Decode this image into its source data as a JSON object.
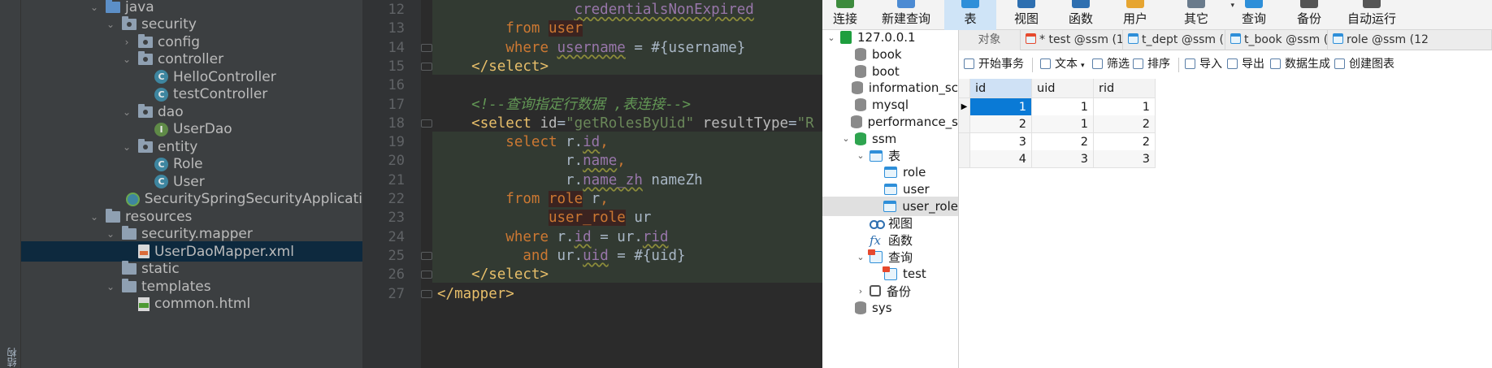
{
  "project_tree": {
    "side_label": "结构",
    "items": [
      {
        "label": "java",
        "indent": 2,
        "chev": "down",
        "icon": "java-folder"
      },
      {
        "label": "security",
        "indent": 3,
        "chev": "down",
        "icon": "package"
      },
      {
        "label": "config",
        "indent": 4,
        "chev": "right",
        "icon": "package"
      },
      {
        "label": "controller",
        "indent": 4,
        "chev": "down",
        "icon": "package"
      },
      {
        "label": "HelloController",
        "indent": 5,
        "chev": "",
        "icon": "class"
      },
      {
        "label": "testController",
        "indent": 5,
        "chev": "",
        "icon": "class"
      },
      {
        "label": "dao",
        "indent": 4,
        "chev": "down",
        "icon": "package"
      },
      {
        "label": "UserDao",
        "indent": 5,
        "chev": "",
        "icon": "interface"
      },
      {
        "label": "entity",
        "indent": 4,
        "chev": "down",
        "icon": "package"
      },
      {
        "label": "Role",
        "indent": 5,
        "chev": "",
        "icon": "class"
      },
      {
        "label": "User",
        "indent": 5,
        "chev": "",
        "icon": "class"
      },
      {
        "label": "SecuritySpringSecurityApplicati",
        "indent": 4,
        "chev": "",
        "icon": "spring-class"
      },
      {
        "label": "resources",
        "indent": 2,
        "chev": "down",
        "icon": "resources-folder"
      },
      {
        "label": "security.mapper",
        "indent": 3,
        "chev": "down",
        "icon": "folder"
      },
      {
        "label": "UserDaoMapper.xml",
        "indent": 4,
        "chev": "",
        "icon": "xml-file",
        "selected": true
      },
      {
        "label": "static",
        "indent": 3,
        "chev": "",
        "icon": "folder"
      },
      {
        "label": "templates",
        "indent": 3,
        "chev": "down",
        "icon": "folder"
      },
      {
        "label": "common.html",
        "indent": 4,
        "chev": "",
        "icon": "html-file"
      }
    ]
  },
  "editor": {
    "line_numbers": [
      "12",
      "13",
      "14",
      "15",
      "16",
      "17",
      "18",
      "19",
      "20",
      "21",
      "22",
      "23",
      "24",
      "25",
      "26",
      "27"
    ],
    "lines": [
      [
        {
          "t": "                ",
          "c": ""
        },
        {
          "t": "credentialsNonExpired",
          "c": "col"
        }
      ],
      [
        {
          "t": "        ",
          "c": ""
        },
        {
          "t": "from ",
          "c": "kw"
        },
        {
          "t": "user",
          "c": "tref"
        }
      ],
      [
        {
          "t": "        ",
          "c": ""
        },
        {
          "t": "where ",
          "c": "kw"
        },
        {
          "t": "username",
          "c": "col"
        },
        {
          "t": " = #{username}",
          "c": ""
        }
      ],
      [
        {
          "t": "    ",
          "c": ""
        },
        {
          "t": "</select>",
          "c": "tag"
        }
      ],
      [
        {
          "t": "",
          "c": ""
        }
      ],
      [
        {
          "t": "    ",
          "c": ""
        },
        {
          "t": "<!--查询指定行数据 ,表连接-->",
          "c": "cmt"
        }
      ],
      [
        {
          "t": "    ",
          "c": ""
        },
        {
          "t": "<select ",
          "c": "tag"
        },
        {
          "t": "id",
          "c": "attr"
        },
        {
          "t": "=",
          "c": ""
        },
        {
          "t": "\"getRolesByUid\"",
          "c": "str"
        },
        {
          "t": " resultType",
          "c": "attr"
        },
        {
          "t": "=",
          "c": ""
        },
        {
          "t": "\"R",
          "c": "str"
        }
      ],
      [
        {
          "t": "        ",
          "c": ""
        },
        {
          "t": "select ",
          "c": "kw"
        },
        {
          "t": "r.",
          "c": ""
        },
        {
          "t": "id",
          "c": "col"
        },
        {
          "t": ",",
          "c": "kw"
        }
      ],
      [
        {
          "t": "               ",
          "c": ""
        },
        {
          "t": "r.",
          "c": ""
        },
        {
          "t": "name",
          "c": "col"
        },
        {
          "t": ",",
          "c": "kw"
        }
      ],
      [
        {
          "t": "               ",
          "c": ""
        },
        {
          "t": "r.",
          "c": ""
        },
        {
          "t": "name_zh",
          "c": "col"
        },
        {
          "t": " nameZh",
          "c": ""
        }
      ],
      [
        {
          "t": "        ",
          "c": ""
        },
        {
          "t": "from ",
          "c": "kw"
        },
        {
          "t": "role",
          "c": "tref"
        },
        {
          "t": " r",
          "c": ""
        },
        {
          "t": ",",
          "c": "kw"
        }
      ],
      [
        {
          "t": "             ",
          "c": ""
        },
        {
          "t": "user_role",
          "c": "tref"
        },
        {
          "t": " ur",
          "c": ""
        }
      ],
      [
        {
          "t": "        ",
          "c": ""
        },
        {
          "t": "where ",
          "c": "kw"
        },
        {
          "t": "r.",
          "c": ""
        },
        {
          "t": "id",
          "c": "col"
        },
        {
          "t": " = ur.",
          "c": ""
        },
        {
          "t": "rid",
          "c": "col"
        }
      ],
      [
        {
          "t": "          ",
          "c": ""
        },
        {
          "t": "and ",
          "c": "kw"
        },
        {
          "t": "ur.",
          "c": ""
        },
        {
          "t": "uid",
          "c": "col"
        },
        {
          "t": " = #{uid}",
          "c": ""
        }
      ],
      [
        {
          "t": "    ",
          "c": ""
        },
        {
          "t": "</select>",
          "c": "tag"
        }
      ],
      [
        {
          "t": "</mapper>",
          "c": "tag"
        }
      ]
    ]
  },
  "navicat": {
    "toolbar": [
      {
        "label": "连接",
        "color": "#3d8b3d"
      },
      {
        "label": "新建查询",
        "color": "#4c8bd3"
      },
      {
        "label": "表",
        "color": "#2e8fd9",
        "active": true
      },
      {
        "label": "视图",
        "color": "#2e6fb0"
      },
      {
        "label": "函数",
        "color": "#2e6fb0"
      },
      {
        "label": "用户",
        "color": "#e6a531"
      },
      {
        "label": "其它",
        "color": "#6a7b8c",
        "dropdown": "▾"
      },
      {
        "label": "查询",
        "color": "#2e8fd9"
      },
      {
        "label": "备份",
        "color": "#555555"
      },
      {
        "label": "自动运行",
        "color": "#555555"
      }
    ],
    "tree": [
      {
        "label": "127.0.0.1",
        "indent": 0,
        "chev": "down",
        "icon": "connection"
      },
      {
        "label": "book",
        "indent": 1,
        "chev": "",
        "icon": "db"
      },
      {
        "label": "boot",
        "indent": 1,
        "chev": "",
        "icon": "db"
      },
      {
        "label": "information_sc",
        "indent": 1,
        "chev": "",
        "icon": "db"
      },
      {
        "label": "mysql",
        "indent": 1,
        "chev": "",
        "icon": "db"
      },
      {
        "label": "performance_s",
        "indent": 1,
        "chev": "",
        "icon": "db"
      },
      {
        "label": "ssm",
        "indent": 1,
        "chev": "down",
        "icon": "db-open"
      },
      {
        "label": "表",
        "indent": 2,
        "chev": "down",
        "icon": "table"
      },
      {
        "label": "role",
        "indent": 3,
        "chev": "",
        "icon": "table"
      },
      {
        "label": "user",
        "indent": 3,
        "chev": "",
        "icon": "table"
      },
      {
        "label": "user_role",
        "indent": 3,
        "chev": "",
        "icon": "table",
        "selected": true
      },
      {
        "label": "视图",
        "indent": 2,
        "chev": "",
        "icon": "view"
      },
      {
        "label": "函数",
        "indent": 2,
        "chev": "",
        "icon": "function"
      },
      {
        "label": "查询",
        "indent": 2,
        "chev": "down",
        "icon": "query"
      },
      {
        "label": "test",
        "indent": 3,
        "chev": "",
        "icon": "query"
      },
      {
        "label": "备份",
        "indent": 2,
        "chev": "right",
        "icon": "backup"
      },
      {
        "label": "sys",
        "indent": 1,
        "chev": "",
        "icon": "db"
      }
    ],
    "tabs": [
      {
        "label": "对象",
        "kind": "obj"
      },
      {
        "label": "* test @ssm (1...",
        "kind": "query"
      },
      {
        "label": "t_dept @ssm (...",
        "kind": "table"
      },
      {
        "label": "t_book @ssm (...",
        "kind": "table"
      },
      {
        "label": "role @ssm (12",
        "kind": "table"
      }
    ],
    "tools": [
      {
        "label": "开始事务"
      },
      {
        "label": "文本",
        "dropdown": "▾"
      },
      {
        "label": "筛选"
      },
      {
        "label": "排序"
      },
      {
        "label": "导入"
      },
      {
        "label": "导出"
      },
      {
        "label": "数据生成"
      },
      {
        "label": "创建图表"
      }
    ],
    "grid": {
      "columns": [
        "id",
        "uid",
        "rid"
      ],
      "rows": [
        [
          "1",
          "1",
          "1"
        ],
        [
          "2",
          "1",
          "2"
        ],
        [
          "3",
          "2",
          "2"
        ],
        [
          "4",
          "3",
          "3"
        ]
      ],
      "current_row_marker": "▶"
    }
  }
}
